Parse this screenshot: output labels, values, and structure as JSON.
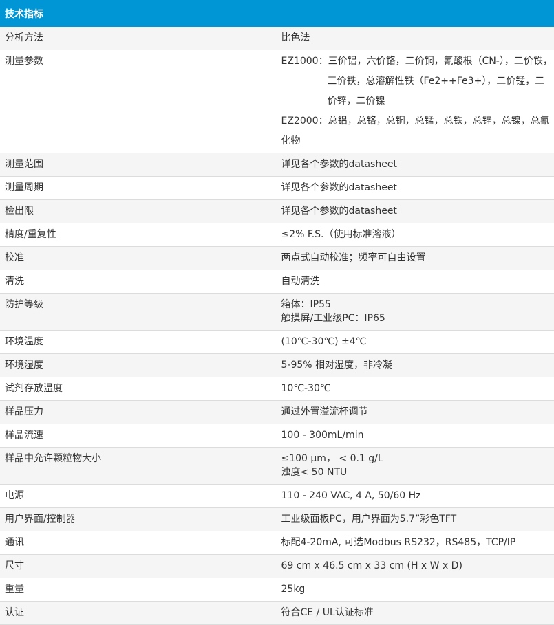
{
  "header": {
    "title": "技术指标"
  },
  "rows": [
    {
      "label": "分析方法",
      "lines": [
        "比色法"
      ]
    },
    {
      "label": "测量参数",
      "lines": [
        "EZ1000：三价铝，六价铬，二价铜，氰酸根（CN-），二价铁，",
        "三价铁，总溶解性铁（Fe2++Fe3+），二价锰，二价锌，二价镍",
        "EZ2000：总铝，总铬，总铜，总锰，总铁，总锌，总镍，总氰化物"
      ]
    },
    {
      "label": "测量范围",
      "lines": [
        "详见各个参数的datasheet"
      ]
    },
    {
      "label": "测量周期",
      "lines": [
        "详见各个参数的datasheet"
      ]
    },
    {
      "label": "检出限",
      "lines": [
        "详见各个参数的datasheet"
      ]
    },
    {
      "label": "精度/重复性",
      "lines": [
        "≤2% F.S.（使用标准溶液）"
      ]
    },
    {
      "label": "校准",
      "lines": [
        "两点式自动校准；频率可自由设置"
      ]
    },
    {
      "label": "清洗",
      "lines": [
        "自动清洗"
      ]
    },
    {
      "label": "防护等级",
      "lines": [
        "箱体：IP55",
        "触摸屏/工业级PC：IP65"
      ]
    },
    {
      "label": "环境温度",
      "lines": [
        "(10℃-30℃) ±4℃"
      ]
    },
    {
      "label": "环境湿度",
      "lines": [
        "5-95% 相对湿度，非冷凝"
      ]
    },
    {
      "label": "试剂存放温度",
      "lines": [
        "10℃-30℃"
      ]
    },
    {
      "label": "样品压力",
      "lines": [
        "通过外置溢流杯调节"
      ]
    },
    {
      "label": "样品流速",
      "lines": [
        "100 - 300mL/min"
      ]
    },
    {
      "label": "样品中允许颗粒物大小",
      "lines": [
        "≤100 µm， < 0.1 g/L",
        "浊度< 50 NTU"
      ]
    },
    {
      "label": "电源",
      "lines": [
        "110 - 240 VAC, 4 A, 50/60 Hz"
      ]
    },
    {
      "label": "用户界面/控制器",
      "lines": [
        "工业级面板PC，用户界面为5.7”彩色TFT"
      ]
    },
    {
      "label": "通讯",
      "lines": [
        "标配4-20mA, 可选Modbus RS232，RS485，TCP/IP"
      ]
    },
    {
      "label": "尺寸",
      "lines": [
        "69 cm x 46.5 cm x 33 cm (H x W x D)"
      ]
    },
    {
      "label": "重量",
      "lines": [
        "25kg"
      ]
    },
    {
      "label": "认证",
      "lines": [
        "符合CE / UL认证标准"
      ]
    }
  ]
}
